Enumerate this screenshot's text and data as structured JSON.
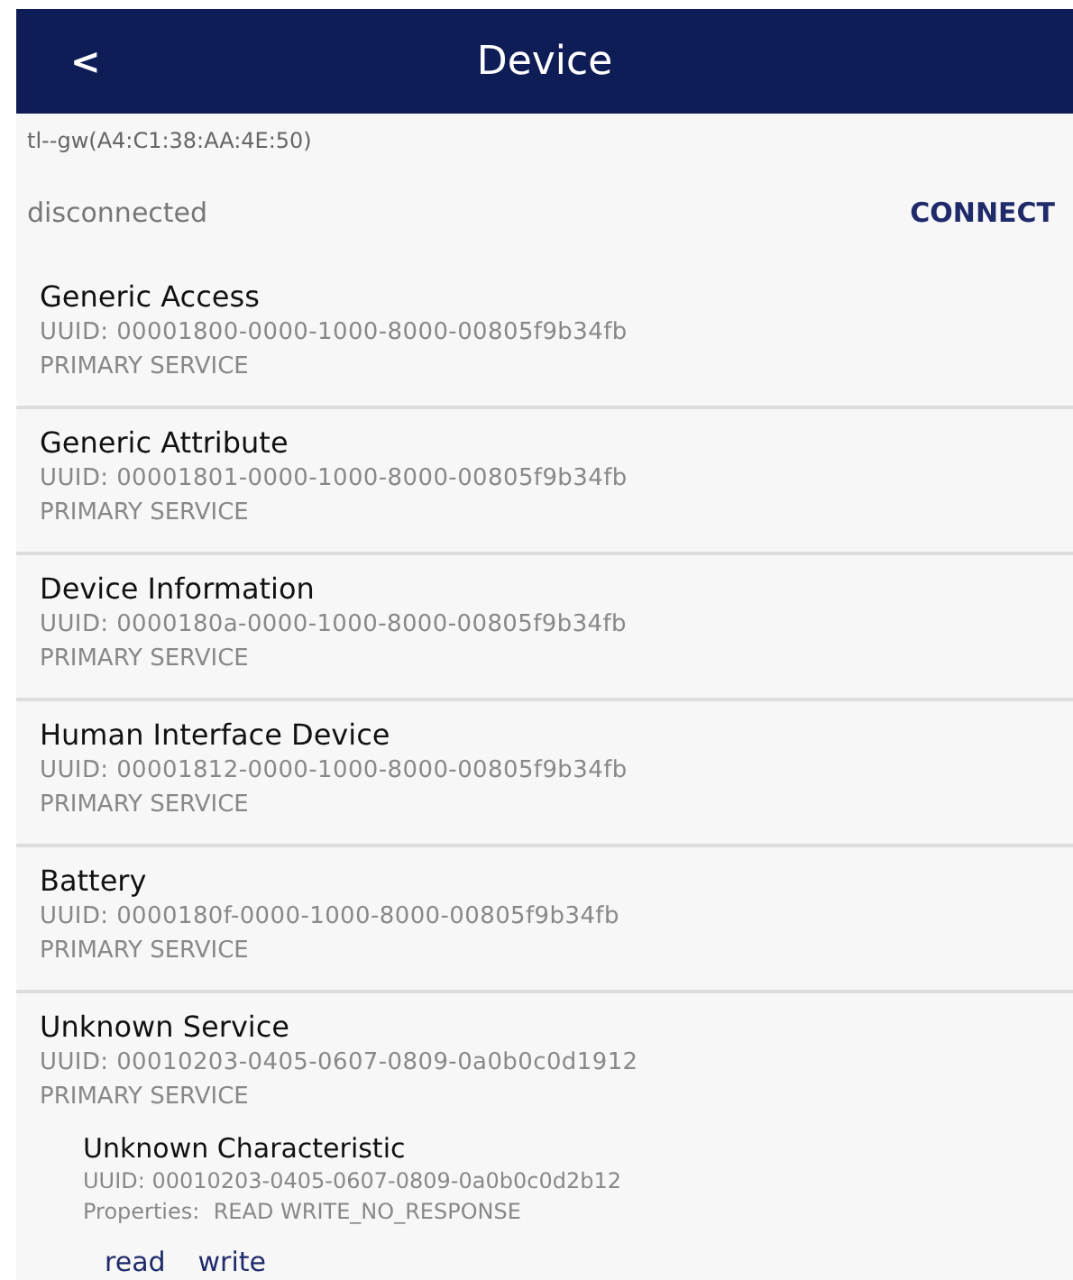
{
  "header": {
    "back": "<",
    "title": "Device"
  },
  "device_name": "tl--gw(A4:C1:38:AA:4E:50)",
  "status": "disconnected",
  "connect_button": "CONNECT",
  "services": [
    {
      "name": "Generic Access",
      "uuid": "UUID: 00001800-0000-1000-8000-00805f9b34fb",
      "type": "PRIMARY SERVICE"
    },
    {
      "name": "Generic Attribute",
      "uuid": "UUID: 00001801-0000-1000-8000-00805f9b34fb",
      "type": "PRIMARY SERVICE"
    },
    {
      "name": "Device Information",
      "uuid": "UUID: 0000180a-0000-1000-8000-00805f9b34fb",
      "type": "PRIMARY SERVICE"
    },
    {
      "name": "Human Interface Device",
      "uuid": "UUID: 00001812-0000-1000-8000-00805f9b34fb",
      "type": "PRIMARY SERVICE"
    },
    {
      "name": "Battery",
      "uuid": "UUID: 0000180f-0000-1000-8000-00805f9b34fb",
      "type": "PRIMARY SERVICE"
    },
    {
      "name": "Unknown Service",
      "uuid": "UUID: 00010203-0405-0607-0809-0a0b0c0d1912",
      "type": "PRIMARY SERVICE",
      "characteristics": [
        {
          "name": "Unknown Characteristic",
          "uuid": "UUID: 00010203-0405-0607-0809-0a0b0c0d2b12",
          "properties": "Properties:  READ WRITE_NO_RESPONSE",
          "actions": [
            "read",
            "write"
          ]
        }
      ]
    }
  ]
}
